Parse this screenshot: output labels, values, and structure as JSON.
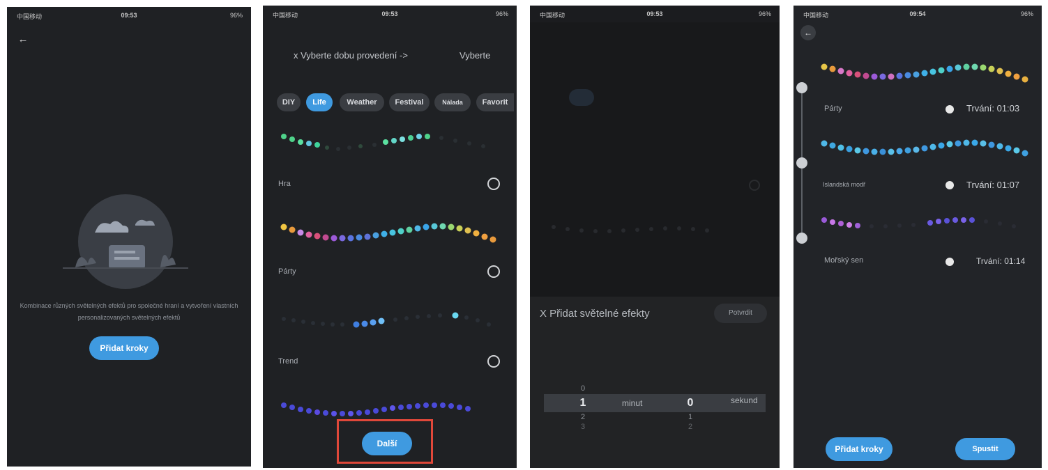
{
  "status": {
    "carrier": "中国移动",
    "battery": "96%"
  },
  "screen1": {
    "time": "09:53",
    "description": "Kombinace různých světelných efektů pro společné hraní a vytvoření vlastních personalizovaných světelných efektů",
    "add_button": "Přidat kroky",
    "icons": [
      "back-arrow-icon",
      "cloud-scene-illustration"
    ]
  },
  "screen2": {
    "time": "09:53",
    "header_title": "x Vyberte dobu provedení ->",
    "header_action": "Vyberte",
    "chips": [
      "DIY",
      "Life",
      "Weather",
      "Festival",
      "Nálada",
      "Favorit"
    ],
    "active_chip": "Life",
    "effects": [
      {
        "name": "Hra"
      },
      {
        "name": "Párty"
      },
      {
        "name": "Trend"
      }
    ],
    "next_button": "Další",
    "highlight_color": "#e0483a"
  },
  "screen3": {
    "time": "09:53",
    "sheet_title": "X Přidat světelné efekty",
    "confirm_button": "Potvrdit",
    "picker": {
      "minutes_column": [
        "0",
        "1",
        "2",
        "3"
      ],
      "selected_minutes": "1",
      "minutes_label": "minut",
      "seconds_column": [
        "0",
        "1",
        "2"
      ],
      "selected_seconds": "0",
      "seconds_label": "sekund"
    }
  },
  "screen4": {
    "time": "09:54",
    "steps": [
      {
        "name": "Párty",
        "duration": "Trvání: 01:03"
      },
      {
        "name": "Islandská modř",
        "duration": "Trvání: 01:07"
      },
      {
        "name": "Mořský sen",
        "duration": "Trvání: 01:14"
      }
    ],
    "add_button": "Přidat kroky",
    "start_button": "Spustit"
  },
  "colors": {
    "accent": "#3f9ae0",
    "background": "#1f2124",
    "highlight": "#e0483a"
  }
}
